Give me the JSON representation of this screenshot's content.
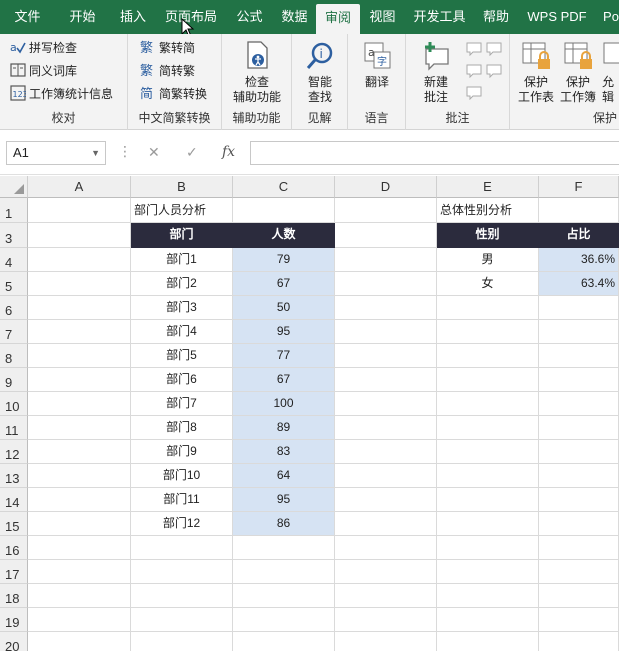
{
  "ribbon_tabs": [
    "文件",
    "开始",
    "插入",
    "页面布局",
    "公式",
    "数据",
    "审阅",
    "视图",
    "开发工具",
    "帮助",
    "WPS PDF",
    "Po"
  ],
  "active_tab": "审阅",
  "ribbon": {
    "proofing": {
      "label": "校对",
      "items": [
        "拼写检查",
        "同义词库",
        "工作簿统计信息"
      ]
    },
    "chinese_conversion": {
      "label": "中文简繁转换",
      "items": [
        "繁转简",
        "简转繁",
        "简繁转换"
      ]
    },
    "accessibility": {
      "label": "辅助功能",
      "button_line1": "检查",
      "button_line2": "辅助功能"
    },
    "insights": {
      "label": "见解",
      "button_line1": "智能",
      "button_line2": "查找"
    },
    "language": {
      "label": "语言",
      "button": "翻译"
    },
    "comments": {
      "label": "批注",
      "button_line1": "新建",
      "button_line2": "批注"
    },
    "protect": {
      "label": "保护",
      "buttons": [
        {
          "line1": "保护",
          "line2": "工作表"
        },
        {
          "line1": "保护",
          "line2": "工作簿"
        },
        {
          "line1": "允",
          "line2": "辑"
        }
      ]
    }
  },
  "formula_bar": {
    "name_box": "A1",
    "cancel_icon": "✕",
    "enter_icon": "✓",
    "fx_label": "fx",
    "formula": ""
  },
  "columns": [
    "A",
    "B",
    "C",
    "D",
    "E",
    "F"
  ],
  "rows": [
    "1",
    "3",
    "4",
    "5",
    "6",
    "7",
    "8",
    "9",
    "10",
    "11",
    "12",
    "13",
    "14",
    "15",
    "16",
    "17",
    "18",
    "19",
    "20"
  ],
  "sheet": {
    "title_dept": "部门人员分析",
    "title_gender": "总体性别分析",
    "dept_header": [
      "部门",
      "人数"
    ],
    "dept_rows": [
      {
        "dept": "部门1",
        "count": "79"
      },
      {
        "dept": "部门2",
        "count": "67"
      },
      {
        "dept": "部门3",
        "count": "50"
      },
      {
        "dept": "部门4",
        "count": "95"
      },
      {
        "dept": "部门5",
        "count": "77"
      },
      {
        "dept": "部门6",
        "count": "67"
      },
      {
        "dept": "部门7",
        "count": "100"
      },
      {
        "dept": "部门8",
        "count": "89"
      },
      {
        "dept": "部门9",
        "count": "83"
      },
      {
        "dept": "部门10",
        "count": "64"
      },
      {
        "dept": "部门11",
        "count": "95"
      },
      {
        "dept": "部门12",
        "count": "86"
      }
    ],
    "gender_header": [
      "性别",
      "占比"
    ],
    "gender_rows": [
      {
        "gender": "男",
        "ratio": "36.6%"
      },
      {
        "gender": "女",
        "ratio": "63.4%"
      }
    ]
  },
  "colors": {
    "ribbon_green": "#217346",
    "table_header": "#2b2b3d",
    "highlight_blue": "#d6e3f3"
  }
}
